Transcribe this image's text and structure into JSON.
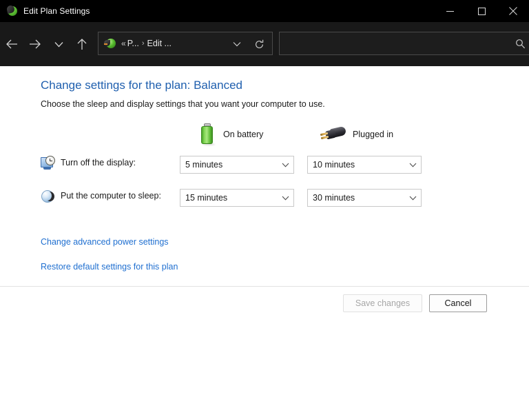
{
  "window": {
    "title": "Edit Plan Settings",
    "icon": "power-plan-icon",
    "controls": {
      "minimize": "minimize-button",
      "maximize": "maximize-button",
      "close": "close-button"
    }
  },
  "navbar": {
    "back": "back-button",
    "forward": "forward-button",
    "recent": "recent-locations-button",
    "up": "up-button",
    "address": {
      "icon": "power-options-icon",
      "overflow": "«",
      "crumb1": "P...",
      "separator": "›",
      "crumb2": "Edit ...",
      "dropdown": "chevron-down-icon",
      "refresh": "refresh-icon"
    },
    "search": {
      "value": "",
      "placeholder": "",
      "icon": "search-icon"
    }
  },
  "content": {
    "heading": "Change settings for the plan: Balanced",
    "subheading": "Choose the sleep and display settings that you want your computer to use.",
    "columns": [
      {
        "label": "On battery",
        "icon": "battery-icon"
      },
      {
        "label": "Plugged in",
        "icon": "power-plug-icon"
      }
    ],
    "rows": [
      {
        "icon": "display-clock-icon",
        "label": "Turn off the display:",
        "on_battery": "5 minutes",
        "plugged_in": "10 minutes"
      },
      {
        "icon": "sleep-moon-icon",
        "label": "Put the computer to sleep:",
        "on_battery": "15 minutes",
        "plugged_in": "30 minutes"
      }
    ],
    "links": [
      "Change advanced power settings",
      "Restore default settings for this plan"
    ]
  },
  "footer": {
    "save_label": "Save changes",
    "save_enabled": false,
    "cancel_label": "Cancel"
  },
  "colors": {
    "titlebar_bg": "#000000",
    "navbar_bg": "#191919",
    "content_bg": "#ffffff",
    "heading_blue": "#1f5fae",
    "link_blue": "#1f6fd0",
    "battery_green": "#7fd552",
    "disabled_text": "#a6a6a6"
  }
}
